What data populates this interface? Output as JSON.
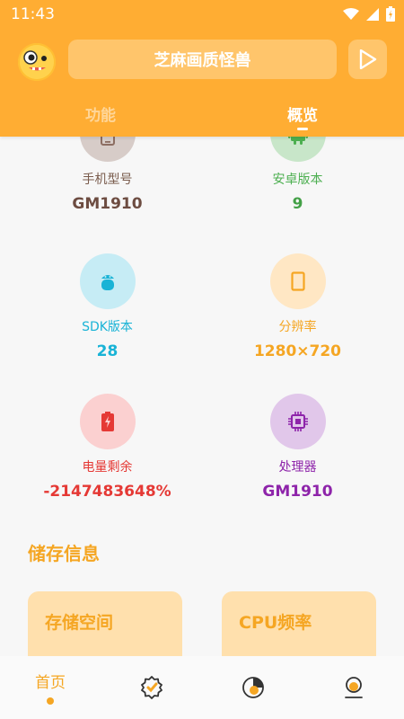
{
  "status_bar": {
    "time": "11:43"
  },
  "header": {
    "title": "芝麻画质怪兽",
    "tabs": [
      {
        "label": "功能",
        "active": false
      },
      {
        "label": "概览",
        "active": true
      }
    ]
  },
  "info_items": [
    {
      "label": "手机型号",
      "value": "GM1910",
      "icon": "phone-icon",
      "color": "#7a5c4d"
    },
    {
      "label": "安卓版本",
      "value": "9",
      "icon": "android-icon",
      "color": "#4caf50"
    },
    {
      "label": "SDK版本",
      "value": "28",
      "icon": "android-sdk-icon",
      "color": "#19b3d6"
    },
    {
      "label": "分辨率",
      "value": "1280×720",
      "icon": "tablet-icon",
      "color": "#f5a623"
    },
    {
      "label": "电量剩余",
      "value": "-2147483648%",
      "icon": "battery-icon",
      "color": "#e53935"
    },
    {
      "label": "处理器",
      "value": "GM1910",
      "icon": "cpu-icon",
      "color": "#8e24aa"
    }
  ],
  "storage_section": {
    "title": "储存信息",
    "cards": [
      {
        "title": "存储空间"
      },
      {
        "title": "CPU频率"
      }
    ]
  },
  "bottom_nav": {
    "items": [
      {
        "label": "首页",
        "icon": "home",
        "active": true
      },
      {
        "label": "",
        "icon": "badge-check-icon",
        "active": false
      },
      {
        "label": "",
        "icon": "pie-chart-icon",
        "active": false
      },
      {
        "label": "",
        "icon": "profile-icon",
        "active": false
      }
    ]
  },
  "colors": {
    "accent": "#ffad33",
    "accent_text": "#f5a623"
  }
}
